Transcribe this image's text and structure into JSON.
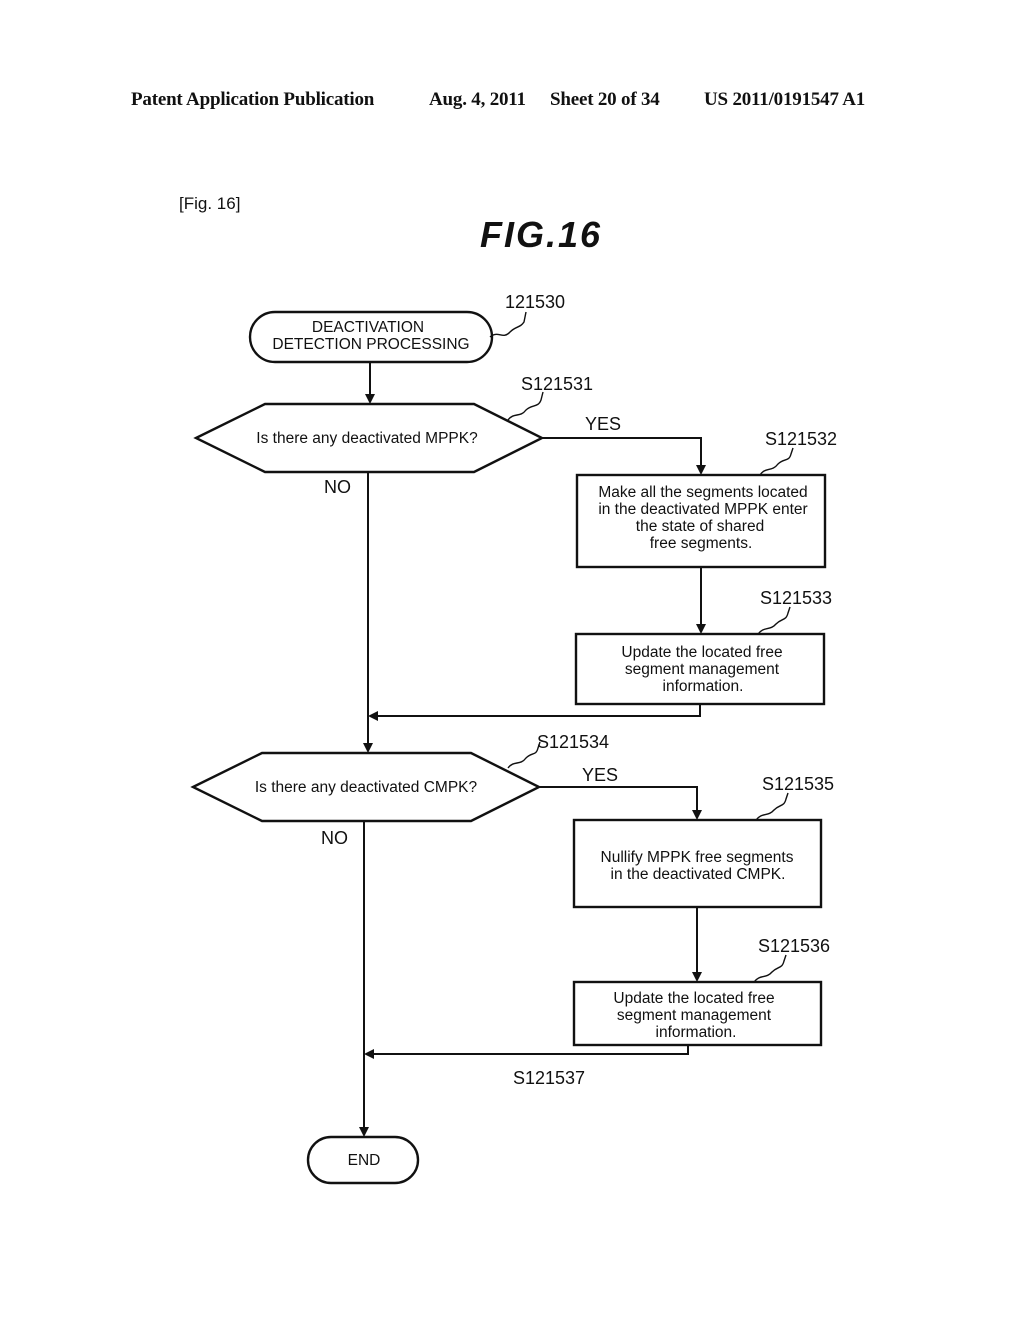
{
  "header": {
    "publication": "Patent Application Publication",
    "date": "Aug. 4, 2011",
    "sheet": "Sheet 20 of 34",
    "pub_number": "US 2011/0191547 A1"
  },
  "figure": {
    "ref_label": "[Fig. 16]",
    "title": "FIG.16"
  },
  "flowchart": {
    "start": {
      "ref": "121530",
      "lines": [
        "DEACTIVATION",
        "DETECTION PROCESSING"
      ]
    },
    "decision1": {
      "ref": "S121531",
      "text": "Is there any deactivated MPPK?",
      "yes_label": "YES",
      "no_label": "NO"
    },
    "step2": {
      "ref": "S121532",
      "lines": [
        "Make all the segments located",
        "in the deactivated MPPK enter",
        "the state of shared",
        "free segments."
      ]
    },
    "step3": {
      "ref": "S121533",
      "lines": [
        "Update the located free",
        "segment management",
        "information."
      ]
    },
    "decision2": {
      "ref": "S121534",
      "text": "Is there any deactivated CMPK?",
      "yes_label": "YES",
      "no_label": "NO"
    },
    "step5": {
      "ref": "S121535",
      "lines": [
        "Nullify MPPK free segments",
        "in the deactivated CMPK."
      ]
    },
    "step6": {
      "ref": "S121536",
      "lines": [
        "Update the located free",
        "segment management",
        "information."
      ]
    },
    "merge": {
      "ref": "S121537"
    },
    "end": {
      "text": "END"
    }
  }
}
